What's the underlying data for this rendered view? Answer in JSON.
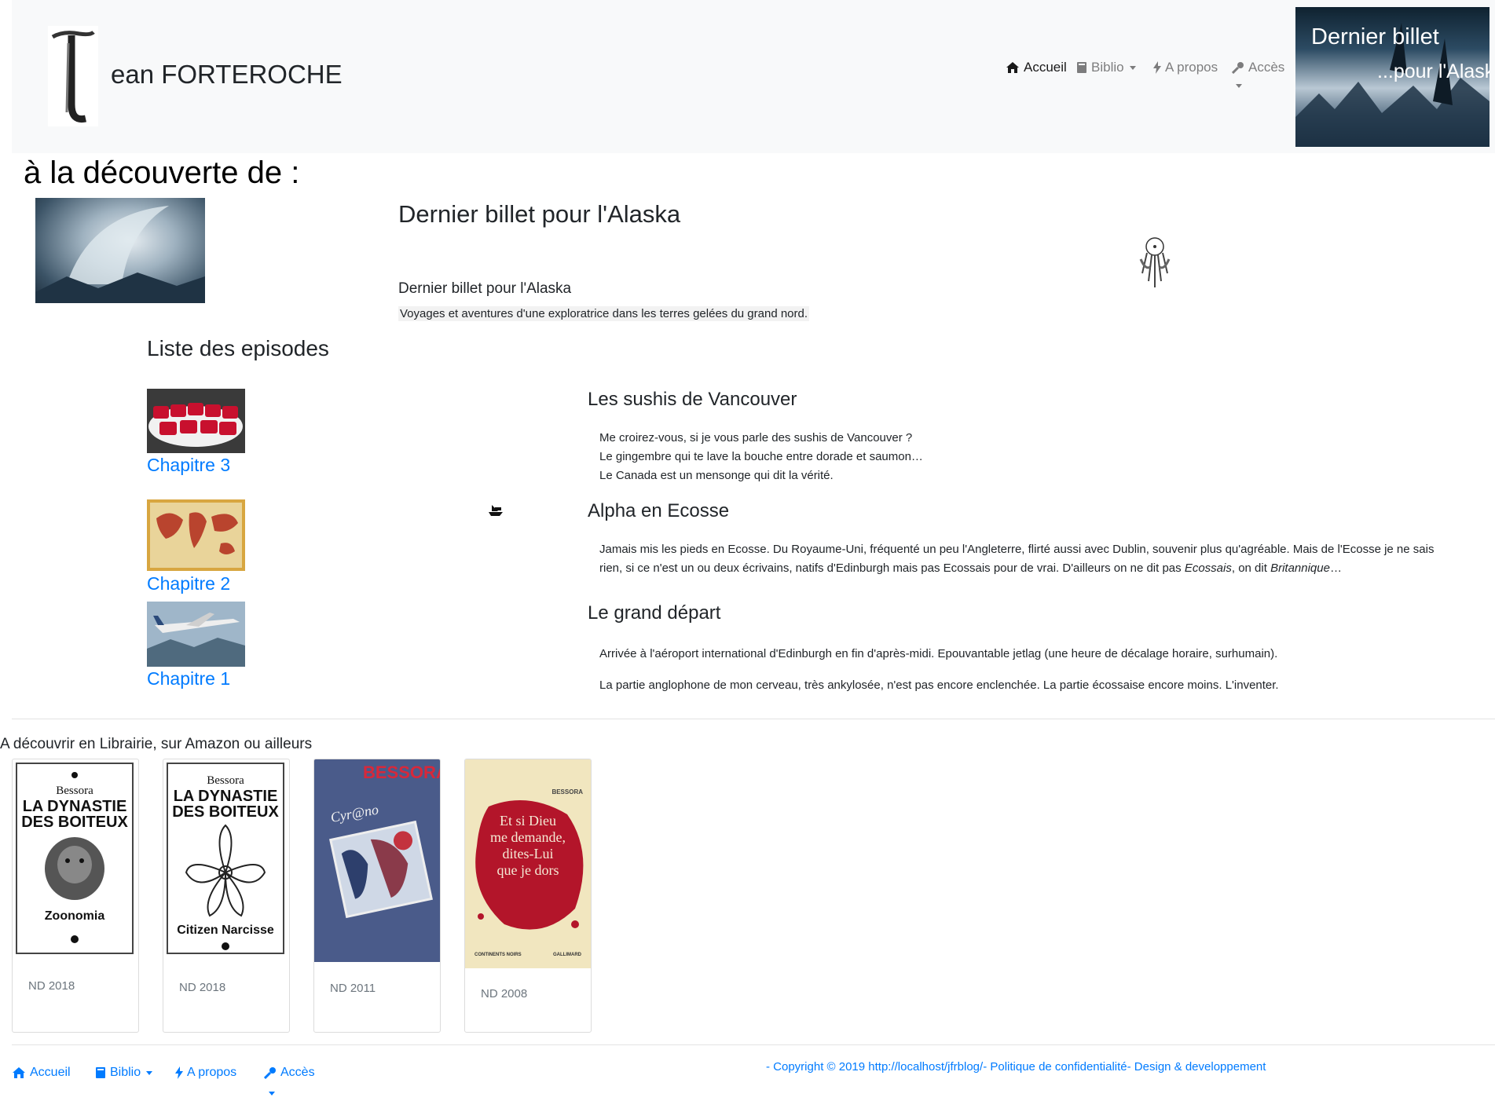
{
  "header": {
    "brand": "ean FORTEROCHE",
    "nav": {
      "home": "Accueil",
      "biblio": "Biblio",
      "about": "A propos",
      "access": "Accès"
    },
    "hero_card": {
      "line1": "Dernier billet",
      "line2": "...pour l'Alaska"
    }
  },
  "discover": {
    "heading": "à la découverte de :",
    "book_title": "Dernier billet pour l'Alaska",
    "book_subtitle": "Dernier billet pour l'Alaska",
    "book_description": "Voyages et aventures d'une exploratrice dans les terres gelées du grand nord."
  },
  "episodes": {
    "heading": "Liste des episodes",
    "chapters": [
      {
        "label": "Chapitre 3",
        "image": "sushi-image"
      },
      {
        "label": "Chapitre 2",
        "image": "world-map-image"
      },
      {
        "label": "Chapitre 1",
        "image": "airplane-image"
      }
    ]
  },
  "posts": [
    {
      "title": "Les sushis de Vancouver",
      "lines": [
        "Me croirez-vous, si je vous parle des sushis de Vancouver ?",
        "Le gingembre qui te lave la bouche entre dorade et saumon…",
        "Le Canada est un mensonge qui dit la vérité."
      ]
    },
    {
      "title": "Alpha en Ecosse",
      "line1": "Jamais mis les pieds en Ecosse. Du Royaume-Uni, fréquenté un peu l'Angleterre, flirté aussi avec Dublin, souvenir plus qu'agréable. Mais de l'Ecosse je ne sais",
      "line2_a": "rien, si ce n'est un ou deux écrivains, natifs d'Edinburgh mais pas Ecossais pour de vrai. D'ailleurs on ne dit pas ",
      "line2_b": "Ecossais",
      "line2_c": ", on dit ",
      "line2_d": "Britannique",
      "line2_e": "…"
    },
    {
      "title": "Le grand départ",
      "para1": "Arrivée à l'aéroport international d'Edinburgh en fin d'après-midi. Epouvantable jetlag (une heure de décalage horaire, surhumain).",
      "para2": "La partie anglophone de mon cerveau, très ankylosée, n'est pas encore enclenchée. La partie écossaise encore moins. L'inventer."
    }
  ],
  "library": {
    "heading": "A découvrir en Librairie, sur Amazon ou ailleurs",
    "books": [
      {
        "author": "Bessora",
        "title_l1": "LA DYNASTIE",
        "title_l2": "DES BOITEUX",
        "subtitle": "Zoonomia",
        "year": "ND 2018"
      },
      {
        "author": "Bessora",
        "title_l1": "LA DYNASTIE",
        "title_l2": "DES BOITEUX",
        "subtitle": "Citizen Narcisse",
        "year": "ND 2018"
      },
      {
        "author": "BESSORA",
        "title": "Cyr@no",
        "year": "ND 2011"
      },
      {
        "author": "BESSORA",
        "title_l1": "Et si Dieu",
        "title_l2": "me demande,",
        "title_l3": "dites-Lui",
        "title_l4": "que je dors",
        "series": "CONTINENTS NOIRS",
        "publisher": "GALLIMARD",
        "year": "ND 2008"
      }
    ]
  },
  "footer": {
    "nav": {
      "home": "Accueil",
      "biblio": "Biblio",
      "about": "A propos",
      "access": "Accès"
    },
    "copyright": "- Copyright © 2019 http://localhost/jfrblog/- Politique de confidentialité- Design & developpement"
  },
  "colors": {
    "link": "#007bff",
    "header_bg": "#f8f9fa",
    "text": "#212529",
    "muted": "#6c757d"
  }
}
